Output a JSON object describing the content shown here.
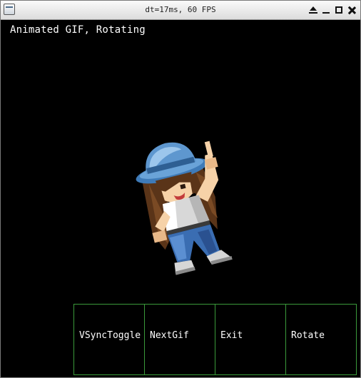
{
  "window": {
    "title": "dt=17ms, 60 FPS"
  },
  "content": {
    "label": "Animated GIF, Rotating"
  },
  "buttons": [
    {
      "label": "VSyncToggle"
    },
    {
      "label": "NextGif"
    },
    {
      "label": "Exit"
    },
    {
      "label": "Rotate"
    }
  ],
  "colors": {
    "background": "#000000",
    "button_border": "#3a9a3a",
    "text": "#ffffff"
  }
}
